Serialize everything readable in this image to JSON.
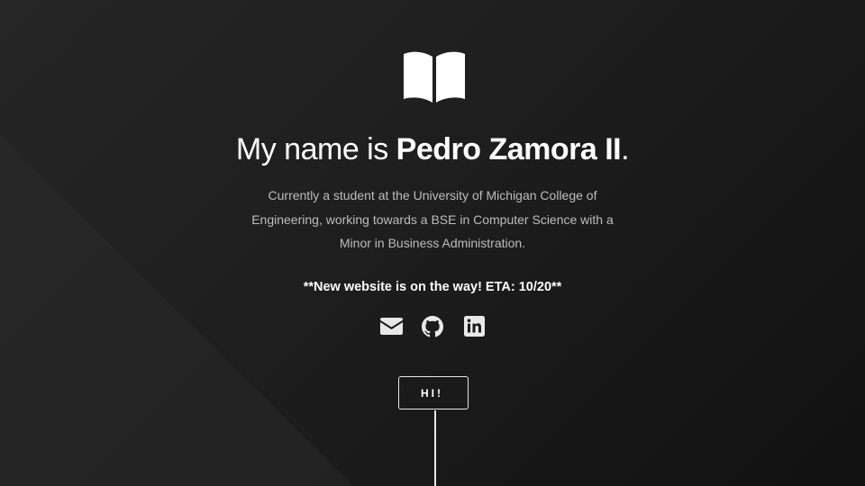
{
  "hero": {
    "icon": "book-open-icon",
    "title_prefix": "My name is ",
    "title_name": "Pedro Zamora II",
    "title_suffix": ".",
    "bio": "Currently a student at the University of Michigan College of Engineering, working towards a BSE in Computer Science with a Minor in Business Administration.",
    "notice": "**New website is on the way! ETA: 10/20**"
  },
  "social": [
    {
      "icon": "envelope-icon"
    },
    {
      "icon": "github-icon"
    },
    {
      "icon": "linkedin-icon"
    }
  ],
  "cta": {
    "label": "HI!"
  },
  "colors": {
    "background": "#1b1b1b",
    "text": "#ffffff",
    "muted_text": "#bdbdbd",
    "icon": "#e8e8e8"
  }
}
